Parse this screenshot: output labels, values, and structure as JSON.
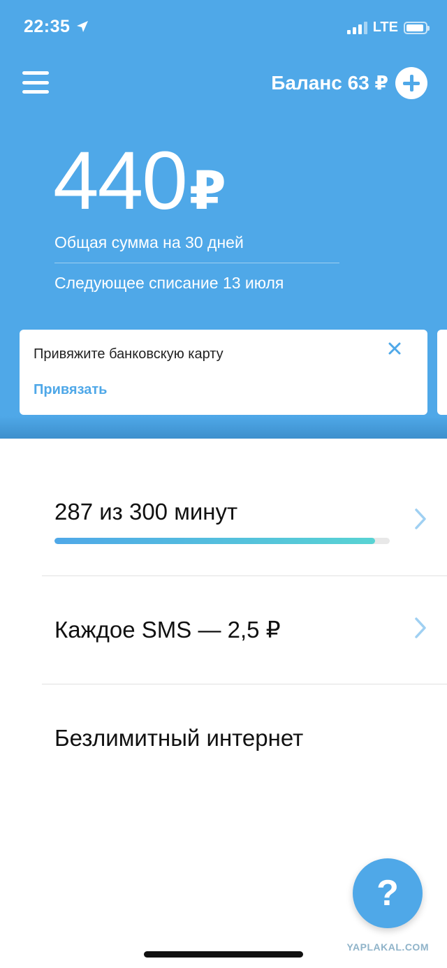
{
  "status_bar": {
    "time": "22:35",
    "network": "LTE",
    "icons": [
      "location-arrow-icon",
      "signal-bars-icon",
      "battery-icon"
    ]
  },
  "header": {
    "balance_label": "Баланс 63 ₽",
    "amount": "440",
    "currency": "₽",
    "total_label": "Общая сумма на 30 дней",
    "next_charge": "Следующее списание 13 июля"
  },
  "card": {
    "text": "Привяжите банковскую карту",
    "action": "Привязать"
  },
  "list": {
    "minutes": {
      "title": "287 из 300 минут",
      "progress": 0.957
    },
    "sms": {
      "title": "Каждое SMS  —  2,5 ₽"
    },
    "internet": {
      "title": "Безлимитный интернет"
    }
  },
  "help": {
    "label": "?"
  },
  "watermark": "YAPLAKAL.COM",
  "colors": {
    "accent": "#4fa8e8",
    "progress_end": "#58d3d3",
    "text": "#111111",
    "divider": "#e1e1e1"
  }
}
